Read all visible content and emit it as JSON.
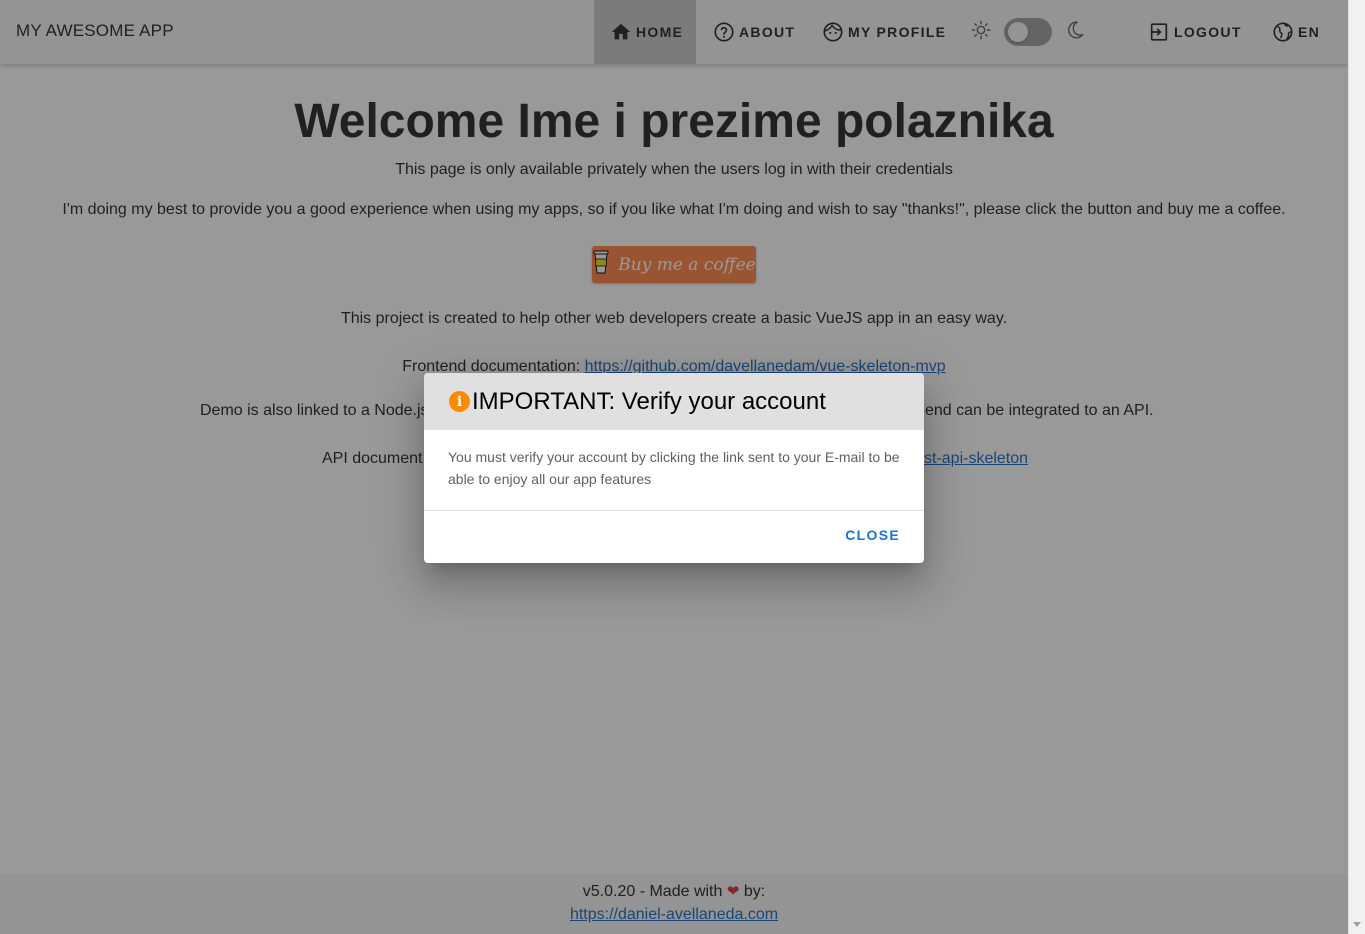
{
  "header": {
    "app_title": "MY AWESOME APP",
    "nav": {
      "home": "HOME",
      "about": "ABOUT",
      "my_profile": "MY PROFILE",
      "logout": "LOGOUT",
      "language": "EN"
    }
  },
  "main": {
    "welcome": "Welcome Ime i prezime polaznika",
    "private_note": "This page is only available privately when the users log in with their credentials",
    "thanks_note": "I'm doing my best to provide you a good experience when using my apps, so if you like what I'm doing and wish to say \"thanks!\", please click the button and buy me a coffee.",
    "coffee_button": "Buy me a coffee",
    "project_note": "This project is created to help other web developers create a basic VueJS app in an easy way.",
    "frontend_doc_label": "Frontend documentation:",
    "frontend_doc_link": "https://github.com/davellanedam/vue-skeleton-mvp",
    "demo_note_start": "Demo is also linked to a Node.js",
    "demo_note_end": "end can be integrated to an API.",
    "api_doc_label": "API document",
    "api_doc_link_fragment": "st-api-skeleton"
  },
  "footer": {
    "version_text": "v5.0.20 - Made with",
    "by_text": "by:",
    "author_link": "https://daniel-avellaneda.com"
  },
  "dialog": {
    "title": "IMPORTANT: Verify your account",
    "body": "You must verify your account by clicking the link sent to your E-mail to be able to enjoy all our app features",
    "close_button": "CLOSE"
  },
  "colors": {
    "accent": "#1976d2",
    "info_icon": "#fb8c00",
    "coffee_button": "#ff813f",
    "heart": "#d32f2f"
  }
}
